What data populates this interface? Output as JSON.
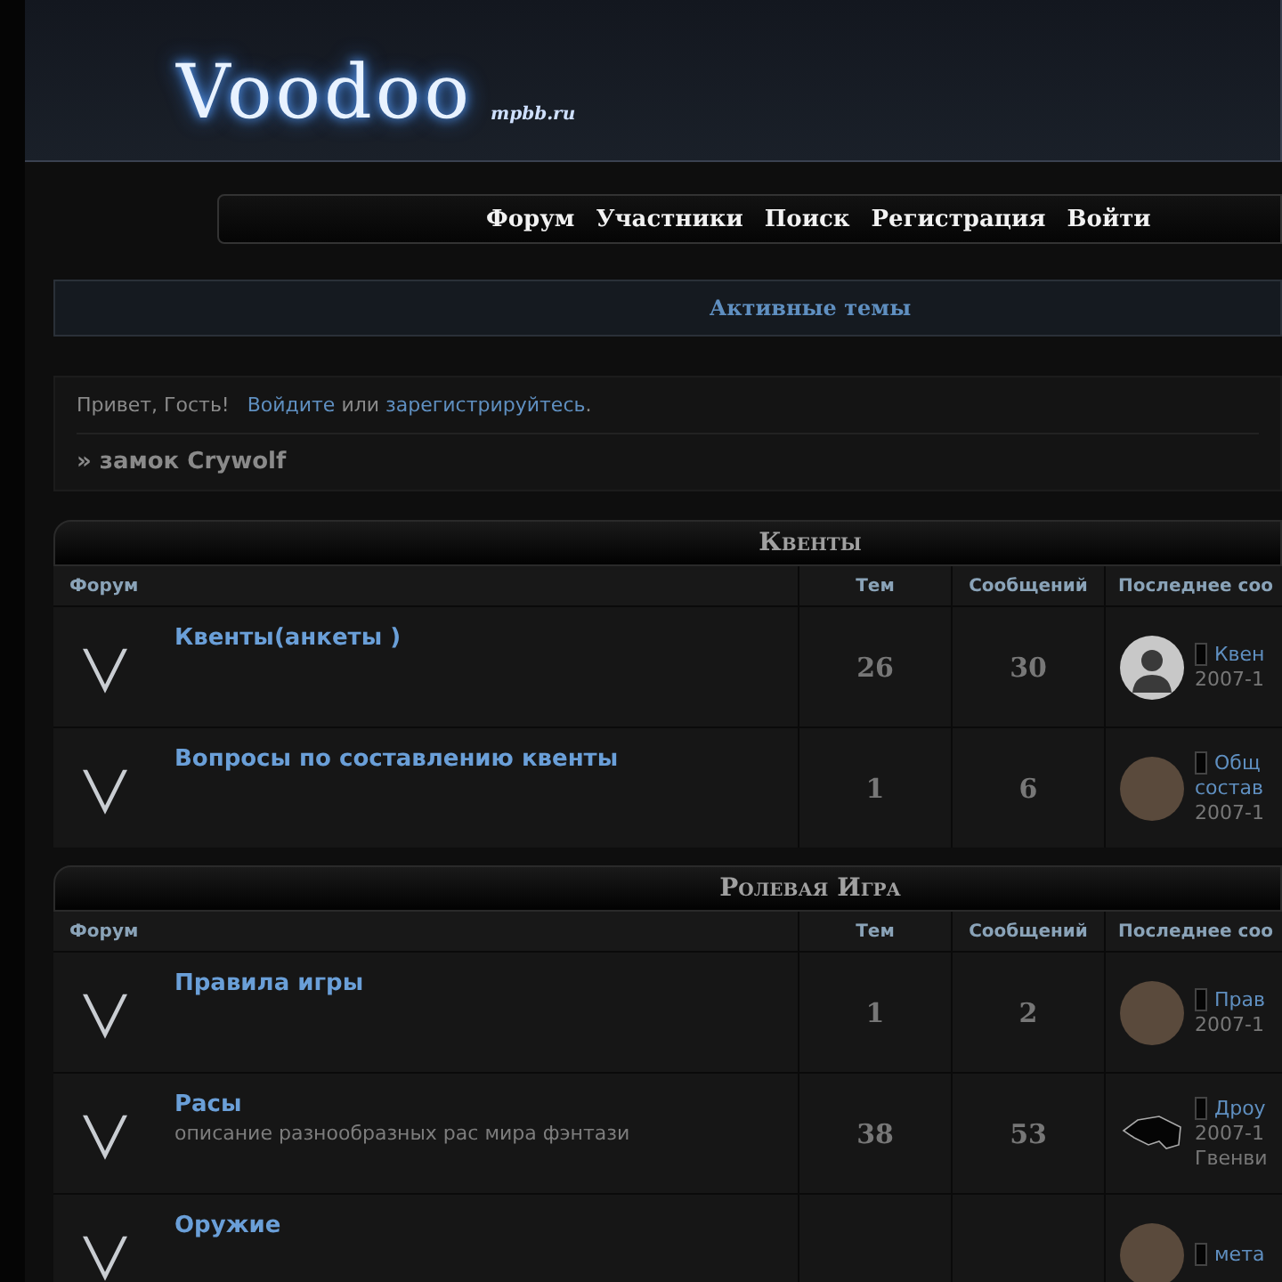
{
  "header": {
    "logo": "Voodoo",
    "domain": "mpbb.ru"
  },
  "nav": [
    "Форум",
    "Участники",
    "Поиск",
    "Регистрация",
    "Войти"
  ],
  "active_topics": "Активные темы",
  "welcome": {
    "greeting": "Привет, Гость!",
    "login": "Войдите",
    "or": "или",
    "register": "зарегистрируйтесь",
    "end": "."
  },
  "breadcrumb": "» замок Crywolf",
  "sections": [
    {
      "title": "Квенты",
      "columns": [
        "Форум",
        "Тем",
        "Сообщений",
        "Последнее соо"
      ],
      "forums": [
        {
          "title": "Квенты(анкеты )",
          "topics": "26",
          "posts": "30",
          "last_post": {
            "kind": "silhouette",
            "lines": [
              "Квен"
            ],
            "date": "2007-1"
          }
        },
        {
          "title": "Вопросы по составлению квенты",
          "topics": "1",
          "posts": "6",
          "last_post": {
            "kind": "photo",
            "lines": [
              "Общ",
              "состав"
            ],
            "date": "2007-1"
          }
        }
      ]
    },
    {
      "title": "Ролевая Игра",
      "columns": [
        "Форум",
        "Тем",
        "Сообщений",
        "Последнее соо"
      ],
      "forums": [
        {
          "title": "Правила игры",
          "topics": "1",
          "posts": "2",
          "last_post": {
            "kind": "photo",
            "lines": [
              "Прав"
            ],
            "date": "2007-1"
          }
        },
        {
          "title": "Расы",
          "description": "описание разнообразных рас мира фэнтази",
          "topics": "38",
          "posts": "53",
          "last_post": {
            "kind": "creature",
            "lines": [
              "Дроу"
            ],
            "date": "2007-1",
            "author": "Гвенви"
          }
        },
        {
          "title": "Оружие",
          "last_post": {
            "kind": "photo",
            "lines": [
              "мета"
            ]
          }
        }
      ]
    }
  ]
}
